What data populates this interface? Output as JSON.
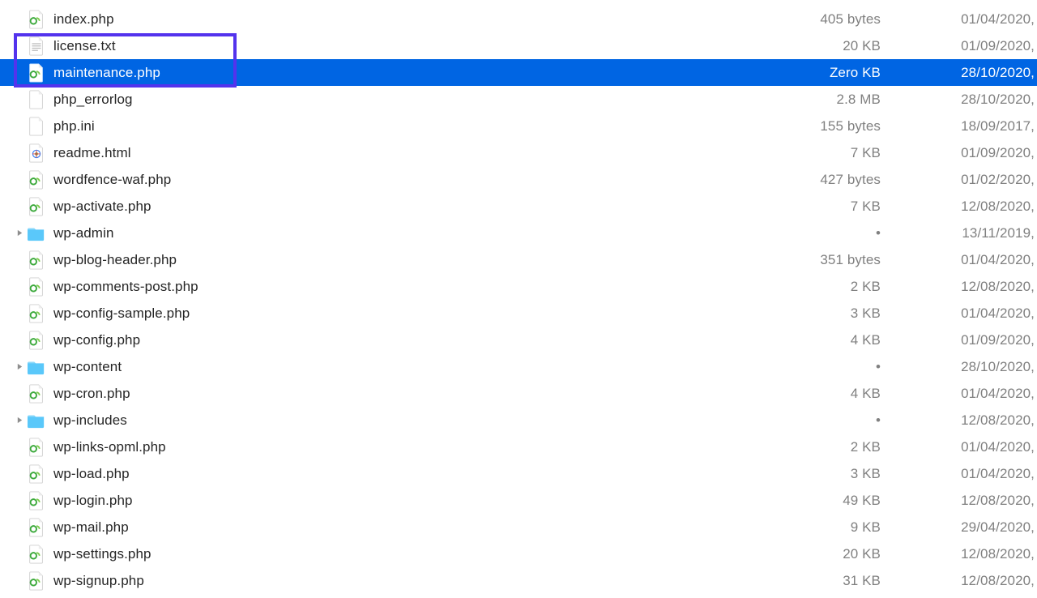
{
  "files": [
    {
      "name": "index.php",
      "size": "405 bytes",
      "date": "01/04/2020,",
      "icon": "php",
      "folder": false,
      "selected": false
    },
    {
      "name": "license.txt",
      "size": "20 KB",
      "date": "01/09/2020,",
      "icon": "txt",
      "folder": false,
      "selected": false
    },
    {
      "name": "maintenance.php",
      "size": "Zero KB",
      "date": "28/10/2020,",
      "icon": "php",
      "folder": false,
      "selected": true
    },
    {
      "name": "php_errorlog",
      "size": "2.8 MB",
      "date": "28/10/2020,",
      "icon": "blank",
      "folder": false,
      "selected": false
    },
    {
      "name": "php.ini",
      "size": "155 bytes",
      "date": "18/09/2017,",
      "icon": "blank",
      "folder": false,
      "selected": false
    },
    {
      "name": "readme.html",
      "size": "7 KB",
      "date": "01/09/2020,",
      "icon": "html",
      "folder": false,
      "selected": false
    },
    {
      "name": "wordfence-waf.php",
      "size": "427 bytes",
      "date": "01/02/2020,",
      "icon": "php",
      "folder": false,
      "selected": false
    },
    {
      "name": "wp-activate.php",
      "size": "7 KB",
      "date": "12/08/2020,",
      "icon": "php",
      "folder": false,
      "selected": false
    },
    {
      "name": "wp-admin",
      "size": "•",
      "date": "13/11/2019,",
      "icon": "folder",
      "folder": true,
      "selected": false
    },
    {
      "name": "wp-blog-header.php",
      "size": "351 bytes",
      "date": "01/04/2020,",
      "icon": "php",
      "folder": false,
      "selected": false
    },
    {
      "name": "wp-comments-post.php",
      "size": "2 KB",
      "date": "12/08/2020,",
      "icon": "php",
      "folder": false,
      "selected": false
    },
    {
      "name": "wp-config-sample.php",
      "size": "3 KB",
      "date": "01/04/2020,",
      "icon": "php",
      "folder": false,
      "selected": false
    },
    {
      "name": "wp-config.php",
      "size": "4 KB",
      "date": "01/09/2020,",
      "icon": "php",
      "folder": false,
      "selected": false
    },
    {
      "name": "wp-content",
      "size": "•",
      "date": "28/10/2020,",
      "icon": "folder",
      "folder": true,
      "selected": false
    },
    {
      "name": "wp-cron.php",
      "size": "4 KB",
      "date": "01/04/2020,",
      "icon": "php",
      "folder": false,
      "selected": false
    },
    {
      "name": "wp-includes",
      "size": "•",
      "date": "12/08/2020,",
      "icon": "folder",
      "folder": true,
      "selected": false
    },
    {
      "name": "wp-links-opml.php",
      "size": "2 KB",
      "date": "01/04/2020,",
      "icon": "php",
      "folder": false,
      "selected": false
    },
    {
      "name": "wp-load.php",
      "size": "3 KB",
      "date": "01/04/2020,",
      "icon": "php",
      "folder": false,
      "selected": false
    },
    {
      "name": "wp-login.php",
      "size": "49 KB",
      "date": "12/08/2020,",
      "icon": "php",
      "folder": false,
      "selected": false
    },
    {
      "name": "wp-mail.php",
      "size": "9 KB",
      "date": "29/04/2020,",
      "icon": "php",
      "folder": false,
      "selected": false
    },
    {
      "name": "wp-settings.php",
      "size": "20 KB",
      "date": "12/08/2020,",
      "icon": "php",
      "folder": false,
      "selected": false
    },
    {
      "name": "wp-signup.php",
      "size": "31 KB",
      "date": "12/08/2020,",
      "icon": "php",
      "folder": false,
      "selected": false
    }
  ]
}
